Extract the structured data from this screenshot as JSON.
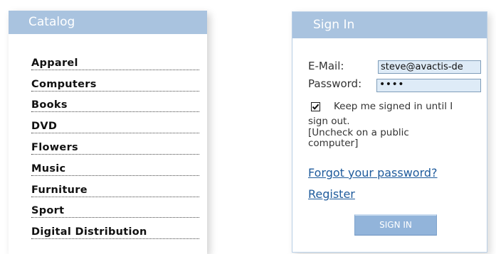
{
  "catalog": {
    "title": "Catalog",
    "items": [
      {
        "label": "Apparel"
      },
      {
        "label": "Computers"
      },
      {
        "label": "Books"
      },
      {
        "label": "DVD"
      },
      {
        "label": "Flowers"
      },
      {
        "label": "Music"
      },
      {
        "label": "Furniture"
      },
      {
        "label": "Sport"
      },
      {
        "label": "Digital Distribution"
      }
    ]
  },
  "signin": {
    "title": "Sign In",
    "email_label": "E-Mail:",
    "email_value": "steve@avactis-de",
    "password_label": "Password:",
    "password_masked": "••••",
    "remember_checked": true,
    "remember_label": "Keep me signed in until I",
    "remember_label_cont": "sign out.",
    "uncheck_note": "[Uncheck on a public computer]",
    "forgot_link": "Forgot your password?",
    "register_link": "Register",
    "button_label": "SIGN IN"
  },
  "colors": {
    "header_bg": "#a9c3df",
    "input_bg": "#deebf7",
    "link": "#1f5b9c",
    "button_bg": "#92b4da"
  }
}
